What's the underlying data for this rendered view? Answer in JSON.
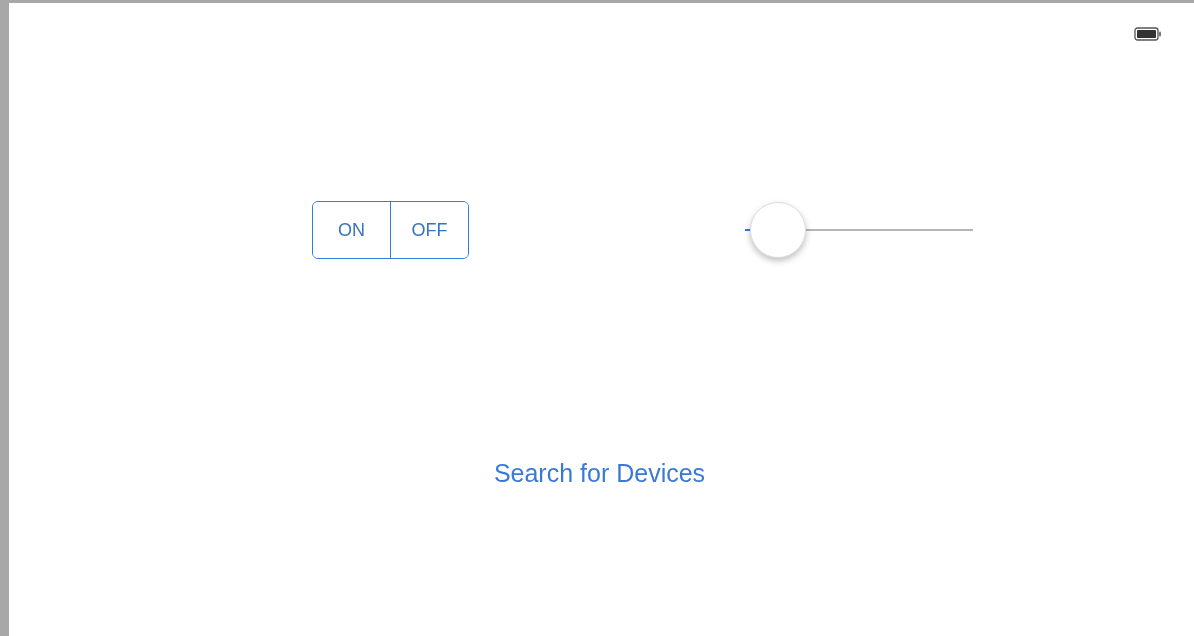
{
  "segmented_control": [
    {
      "label": "ON",
      "selected": false
    },
    {
      "label": "OFF",
      "selected": false
    }
  ],
  "slider": {
    "level": 0
  },
  "button": {
    "label": "Search for Devices"
  }
}
